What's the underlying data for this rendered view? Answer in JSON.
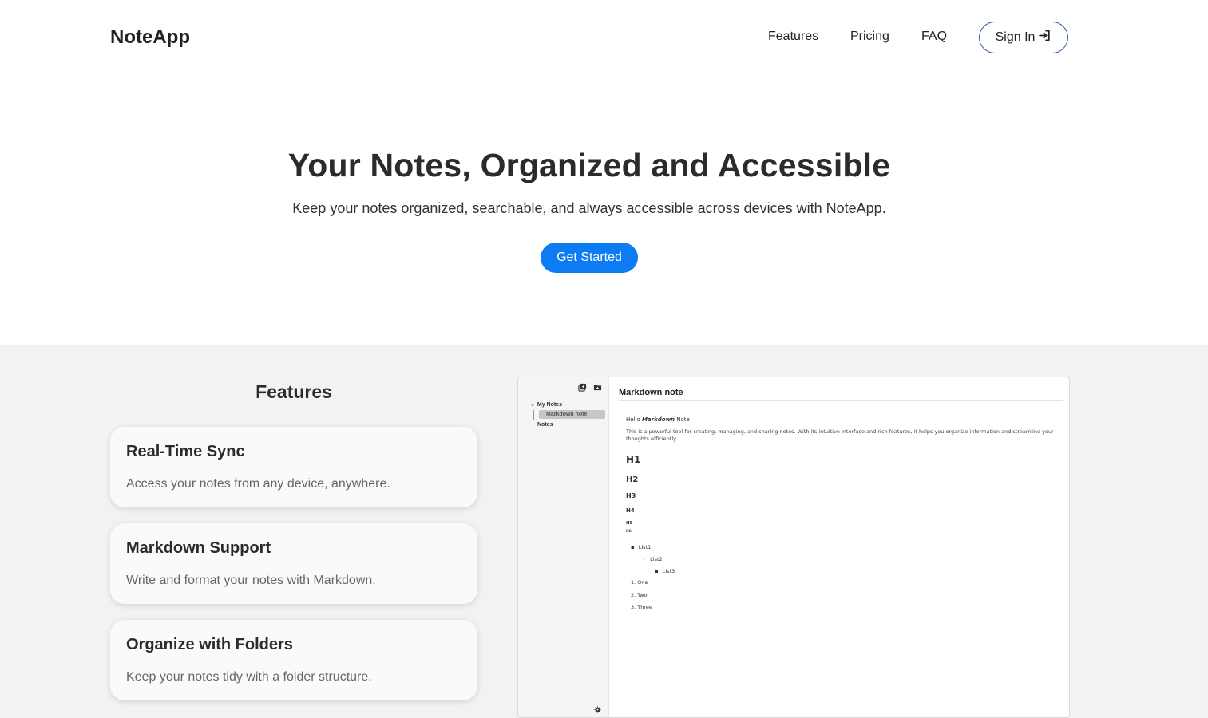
{
  "nav": {
    "brand": "NoteApp",
    "links": [
      "Features",
      "Pricing",
      "FAQ"
    ],
    "signin_label": "Sign In",
    "signin_icon": "sign-in-icon"
  },
  "hero": {
    "title": "Your Notes, Organized and Accessible",
    "subtitle": "Keep your notes organized, searchable, and always accessible across devices with NoteApp.",
    "cta_label": "Get Started"
  },
  "features": {
    "heading": "Features",
    "cards": [
      {
        "title": "Real-Time Sync",
        "description": "Access your notes from any device, anywhere."
      },
      {
        "title": "Markdown Support",
        "description": "Write and format your notes with Markdown."
      },
      {
        "title": "Organize with Folders",
        "description": "Keep your notes tidy with a folder structure."
      }
    ]
  },
  "preview": {
    "sidebar": {
      "folder": "My Notes",
      "active_note": "Markdown note",
      "other_item": "Notes"
    },
    "note": {
      "title": "Markdown note",
      "hello_prefix": "Hello ",
      "hello_emph": "Markdown",
      "hello_suffix": " Note",
      "paragraph": "This is a powerful tool for creating, managing, and sharing notes. With its intuitive interface and rich features, it helps you organize information and streamline your thoughts efficiently.",
      "headings": [
        "H1",
        "H2",
        "H3",
        "H4",
        "H5",
        "H6"
      ],
      "bullets": [
        "List1",
        "List2",
        "List3"
      ],
      "ordered": [
        "1. One",
        "2. Two",
        "3. Three"
      ]
    }
  },
  "colors": {
    "primary": "#0d7bf2",
    "signin_border": "#2c5aa0",
    "section_bg": "#f2f2f2"
  }
}
